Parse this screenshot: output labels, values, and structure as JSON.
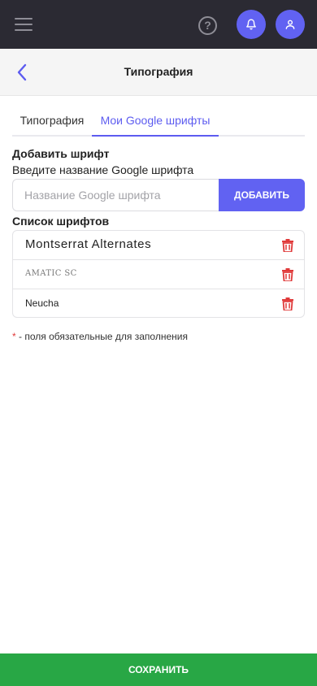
{
  "topbar": {
    "menu_icon": "hamburger-icon",
    "help_icon": "question-circle-icon",
    "help_glyph": "?",
    "bell_icon": "bell-icon",
    "user_icon": "user-icon",
    "accent": "#6162f2",
    "background": "#2b2a33"
  },
  "header": {
    "back_icon": "chevron-left-icon",
    "title": "Типография"
  },
  "tabs": [
    {
      "label": "Типография",
      "active": false
    },
    {
      "label": "Мои Google шрифты",
      "active": true
    }
  ],
  "add_font": {
    "heading": "Добавить шрифт",
    "label": "Введите название Google шрифта",
    "placeholder": "Название Google шрифта",
    "value": "",
    "button_label": "ДОБАВИТЬ"
  },
  "font_list": {
    "heading": "Список шрифтов",
    "items": [
      {
        "name": "Montserrat Alternates"
      },
      {
        "name": "AMATIC SC"
      },
      {
        "name": "Neucha"
      }
    ],
    "delete_icon": "trash-icon",
    "delete_color": "#e03a3a"
  },
  "note": {
    "star": "*",
    "text": " - поля обязательные для заполнения"
  },
  "save_button": {
    "label": "СОХРАНИТЬ",
    "color": "#28a745"
  }
}
